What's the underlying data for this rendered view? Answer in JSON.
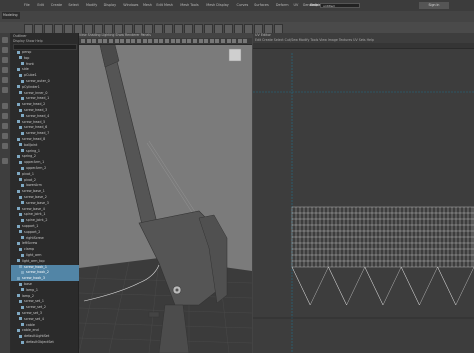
{
  "menubar": {
    "items": [
      "File",
      "Edit",
      "Create",
      "Select",
      "Modify",
      "Display",
      "Windows",
      "Mesh",
      "Edit Mesh",
      "Mesh Tools",
      "Mesh Display",
      "Curves",
      "Surfaces",
      "Deform",
      "UV",
      "Generate",
      "Cache",
      "Arnold",
      "Help"
    ],
    "status_field": "untitled",
    "user_label": "Sign In"
  },
  "shelf": {
    "mode": "Modeling",
    "tabs": [
      "Curves / Surfaces",
      "Poly Modeling",
      "Sculpting",
      "Rigging",
      "Animation",
      "Rendering",
      "FX",
      "FX Caching",
      "Custom",
      "Arnold",
      "Bifrost",
      "MASH",
      "Motion Graphics",
      "XGen"
    ]
  },
  "outliner": {
    "title": "Outliner",
    "menu": "Display  Show  Help",
    "rows": [
      {
        "label": "persp",
        "selected": false
      },
      {
        "label": "top",
        "selected": false
      },
      {
        "label": "front",
        "selected": false
      },
      {
        "label": "side",
        "selected": false
      },
      {
        "label": "pCube1",
        "selected": false
      },
      {
        "label": "screw_outer_0",
        "selected": false
      },
      {
        "label": "pCylinder1",
        "selected": false
      },
      {
        "label": "screw_inner_0",
        "selected": false
      },
      {
        "label": "screw_head_1",
        "selected": false
      },
      {
        "label": "screw_head_2",
        "selected": false
      },
      {
        "label": "screw_head_3",
        "selected": false
      },
      {
        "label": "screw_head_4",
        "selected": false
      },
      {
        "label": "screw_head_5",
        "selected": false
      },
      {
        "label": "screw_head_6",
        "selected": false
      },
      {
        "label": "screw_head_7",
        "selected": false
      },
      {
        "label": "screw_head_8",
        "selected": false
      },
      {
        "label": "ballJoint",
        "selected": false
      },
      {
        "label": "spring_1",
        "selected": false
      },
      {
        "label": "spring_2",
        "selected": false
      },
      {
        "label": "upperArm_1",
        "selected": false
      },
      {
        "label": "upperArm_2",
        "selected": false
      },
      {
        "label": "pivot_1",
        "selected": false
      },
      {
        "label": "pivot_2",
        "selected": false
      },
      {
        "label": "lowerArm",
        "selected": false
      },
      {
        "label": "screw_base_1",
        "selected": false
      },
      {
        "label": "screw_base_2",
        "selected": false
      },
      {
        "label": "screw_base_3",
        "selected": false
      },
      {
        "label": "screw_base_4",
        "selected": false
      },
      {
        "label": "spine_joint_1",
        "selected": false
      },
      {
        "label": "spine_joint_2",
        "selected": false
      },
      {
        "label": "support_1",
        "selected": false
      },
      {
        "label": "support_2",
        "selected": false
      },
      {
        "label": "rightScrew",
        "selected": false
      },
      {
        "label": "leftScrew",
        "selected": false
      },
      {
        "label": "clamp",
        "selected": false
      },
      {
        "label": "light_arm",
        "selected": false
      },
      {
        "label": "light_arm_top",
        "selected": false
      },
      {
        "label": "screw_hook_1",
        "selected": true
      },
      {
        "label": "screw_hook_2",
        "selected": true
      },
      {
        "label": "screw_hook_3",
        "selected": true
      },
      {
        "label": "base",
        "selected": false
      },
      {
        "label": "lamp_1",
        "selected": false
      },
      {
        "label": "lamp_2",
        "selected": false
      },
      {
        "label": "screw_set_1",
        "selected": false
      },
      {
        "label": "screw_set_2",
        "selected": false
      },
      {
        "label": "screw_set_3",
        "selected": false
      },
      {
        "label": "screw_set_4",
        "selected": false
      },
      {
        "label": "cable",
        "selected": false
      },
      {
        "label": "cable_end",
        "selected": false
      },
      {
        "label": "defaultLightSet",
        "selected": false
      },
      {
        "label": "defaultObjectSet",
        "selected": false
      }
    ]
  },
  "viewport": {
    "menu": "View  Shading  Lighting  Show  Renderer  Panels",
    "viewcube": "FRONT"
  },
  "graph_editor": {
    "title": "UV Editor",
    "menu": "Edit  Create  Select  Cut/Sew  Modify  Tools  View  Image  Textures  UV Sets  Help"
  },
  "colors": {
    "selection": "#5285a6",
    "viewport_bg": "#7b7b7b",
    "panel_bg": "#2b2b2b"
  }
}
